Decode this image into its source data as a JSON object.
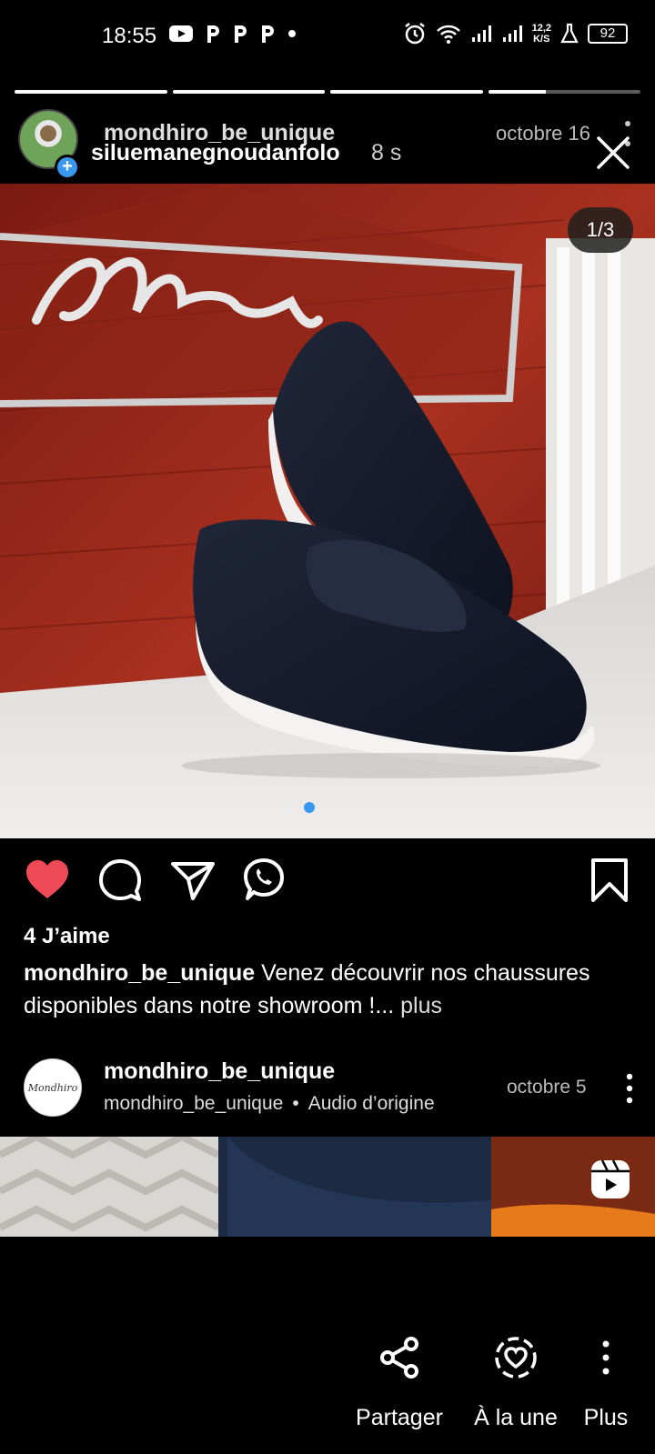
{
  "status_bar": {
    "time": "18:55",
    "net_speed_value": "12,2",
    "net_speed_unit": "K/S",
    "battery": "92"
  },
  "story": {
    "progress": [
      1,
      1,
      1,
      0.38
    ],
    "user": "siluemanegnoudanfolo",
    "time_ago": "8 s",
    "close_icon": "close-icon"
  },
  "post": {
    "username": "mondhiro_be_unique",
    "date": "octobre 16",
    "image_counter": "1/3",
    "likes": "4 J’aime",
    "caption_user": "mondhiro_be_unique",
    "caption_text": " Venez découvrir nos chaussures disponibles dans notre showroom !...",
    "caption_more": " plus",
    "logo_text": "Mondhiro"
  },
  "post2": {
    "username": "mondhiro_be_unique",
    "subtitle_user": "mondhiro_be_unique",
    "separator": "•",
    "audio": "Audio d’origine",
    "date": "octobre 5",
    "avatar_text": "Mondhiro"
  },
  "bottom_bar": {
    "share": "Partager",
    "highlight": "À la une",
    "more": "Plus"
  },
  "colors": {
    "heart": "#ed4956",
    "accent_blue": "#3897f0",
    "background": "#000000"
  }
}
